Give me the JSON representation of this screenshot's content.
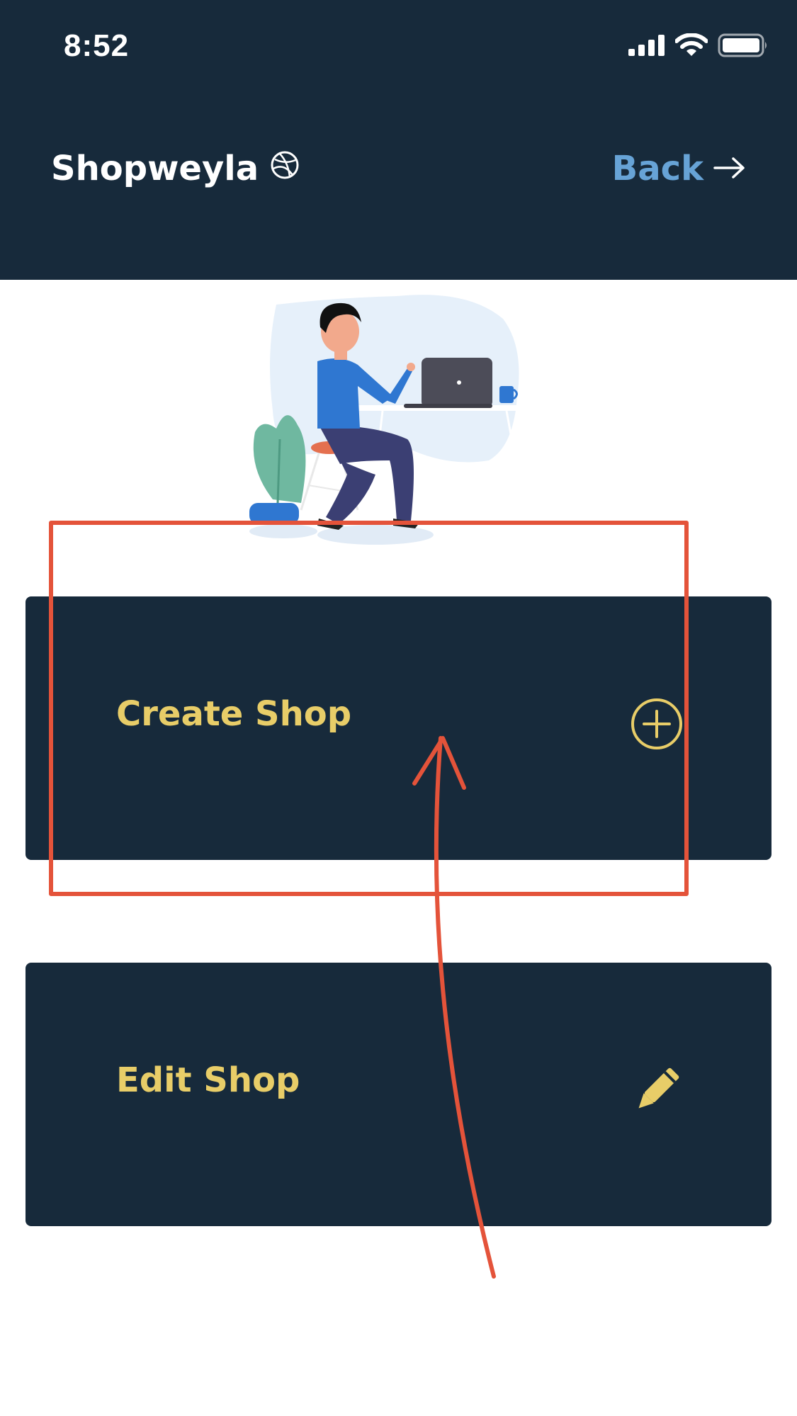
{
  "status_bar": {
    "time": "8:52",
    "icons": [
      "cellular-signal-icon",
      "wifi-icon",
      "battery-icon"
    ]
  },
  "header": {
    "title": "Shopweyla",
    "title_icon": "dribbble-icon",
    "back_label": "Back",
    "back_icon": "arrow-right-icon"
  },
  "illustration": {
    "description_icon": "person-at-desk-illustration"
  },
  "actions": {
    "create_shop": {
      "label": "Create Shop",
      "icon": "plus-circle-icon"
    },
    "edit_shop": {
      "label": "Edit Shop",
      "icon": "pencil-icon"
    }
  },
  "colors": {
    "header_bg": "#172a3b",
    "card_bg": "#172a3b",
    "accent_yellow": "#e8cd68",
    "link_blue": "#67a3d6",
    "annotation_red": "#e4533a"
  }
}
